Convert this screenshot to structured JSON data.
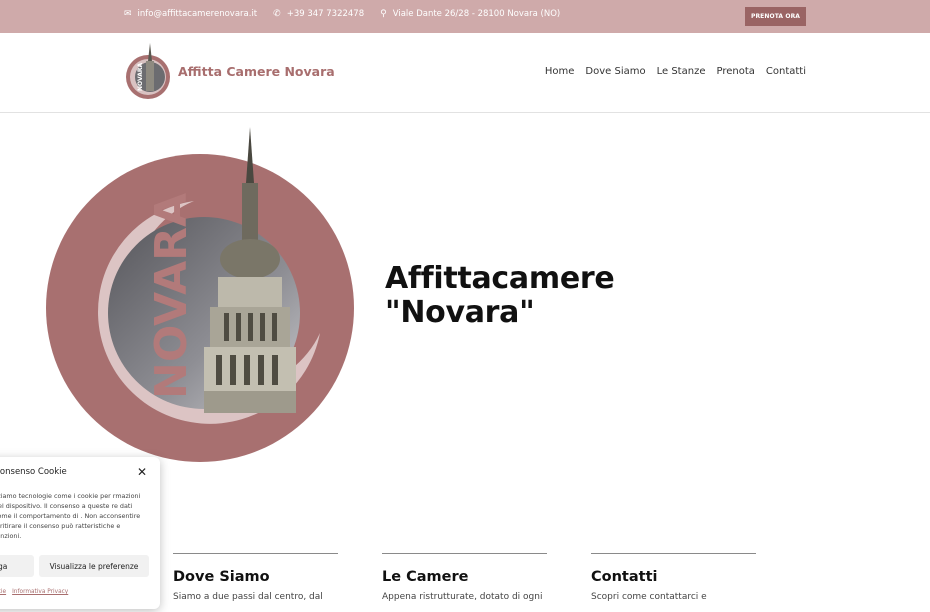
{
  "topbar": {
    "email": "info@affittacamerenovara.it",
    "phone": "+39 347 7322478",
    "address": "Viale Dante 26/28 - 28100 Novara (NO)",
    "book_button": "PRENOTA ORA"
  },
  "header": {
    "brand": "Affitta Camere Novara",
    "nav": [
      "Home",
      "Dove Siamo",
      "Le Stanze",
      "Prenota",
      "Contatti"
    ]
  },
  "hero": {
    "title_line1": "Affittacamere",
    "title_line2": "\"Novara\"",
    "logo_word": "NOVARA"
  },
  "columns": [
    {
      "title": "Dove Siamo",
      "text": "Siamo a due passi dal centro, dal"
    },
    {
      "title": "Le Camere",
      "text": "Appena ristrutturate, dotato di ogni"
    },
    {
      "title": "Contatti",
      "text": "Scopri come contattarci e"
    }
  ],
  "cookie": {
    "title": "Consenso Cookie",
    "text": "zziamo tecnologie come i cookie per rmazioni del dispositivo. Il consenso a queste re dati come il comportamento di . Non acconsentire o ritirare il consenso può ratteristiche e funzioni.",
    "deny_button": "ga",
    "prefs_button": "Visualizza le preferenze",
    "link_cookie": "okie",
    "link_privacy": "Informativa Privacy"
  },
  "colors": {
    "topbar": "#cfaaaa",
    "accent": "#9a6464",
    "brand": "#a86e6e",
    "logo_circle": "#a87070"
  }
}
